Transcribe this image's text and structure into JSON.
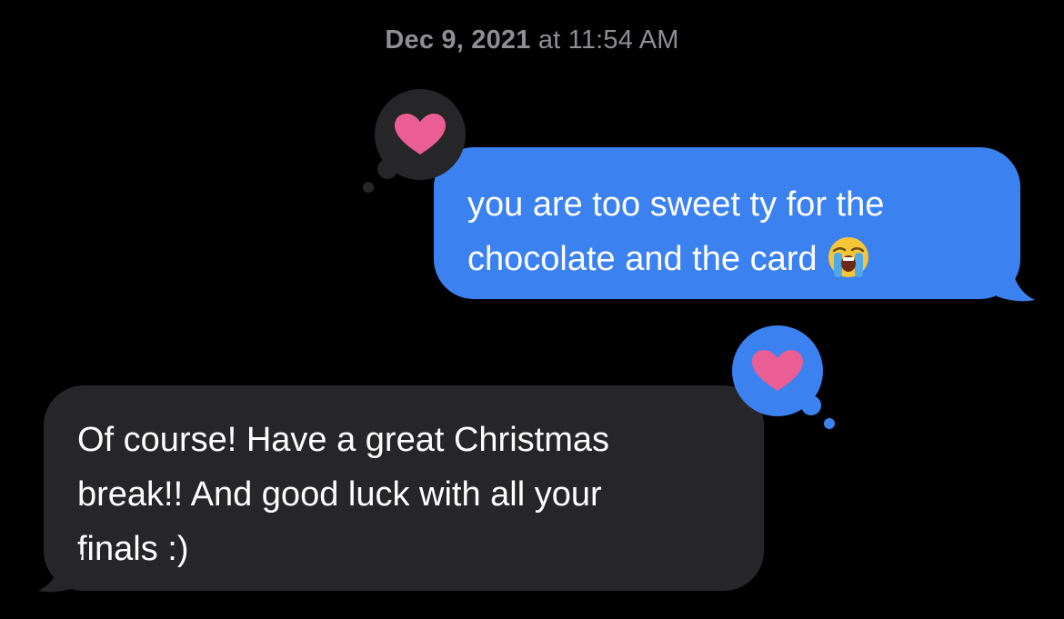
{
  "thread": {
    "timestamp_date": "Dec 9, 2021",
    "timestamp_time": " at 11:54 AM"
  },
  "messages": [
    {
      "direction": "outgoing",
      "line1": "you are too sweet ty for the",
      "line2": "chocolate and the card",
      "emoji": "loudly-crying-face",
      "reaction": "heart",
      "bubble_color": "#3b82f0"
    },
    {
      "direction": "incoming",
      "line1": "Of course! Have a great Christmas",
      "line2": "break!! And good luck with all your",
      "line3": "finals :)",
      "reaction": "heart",
      "bubble_color": "#262629"
    }
  ],
  "colors": {
    "background": "#000000",
    "timestamp": "#8e8e93",
    "outgoing_bubble": "#3b82f0",
    "incoming_bubble": "#262629",
    "heart": "#ea5e93",
    "reaction_bubble_on_outgoing": "#262629",
    "reaction_bubble_on_incoming": "#3b82f0"
  }
}
